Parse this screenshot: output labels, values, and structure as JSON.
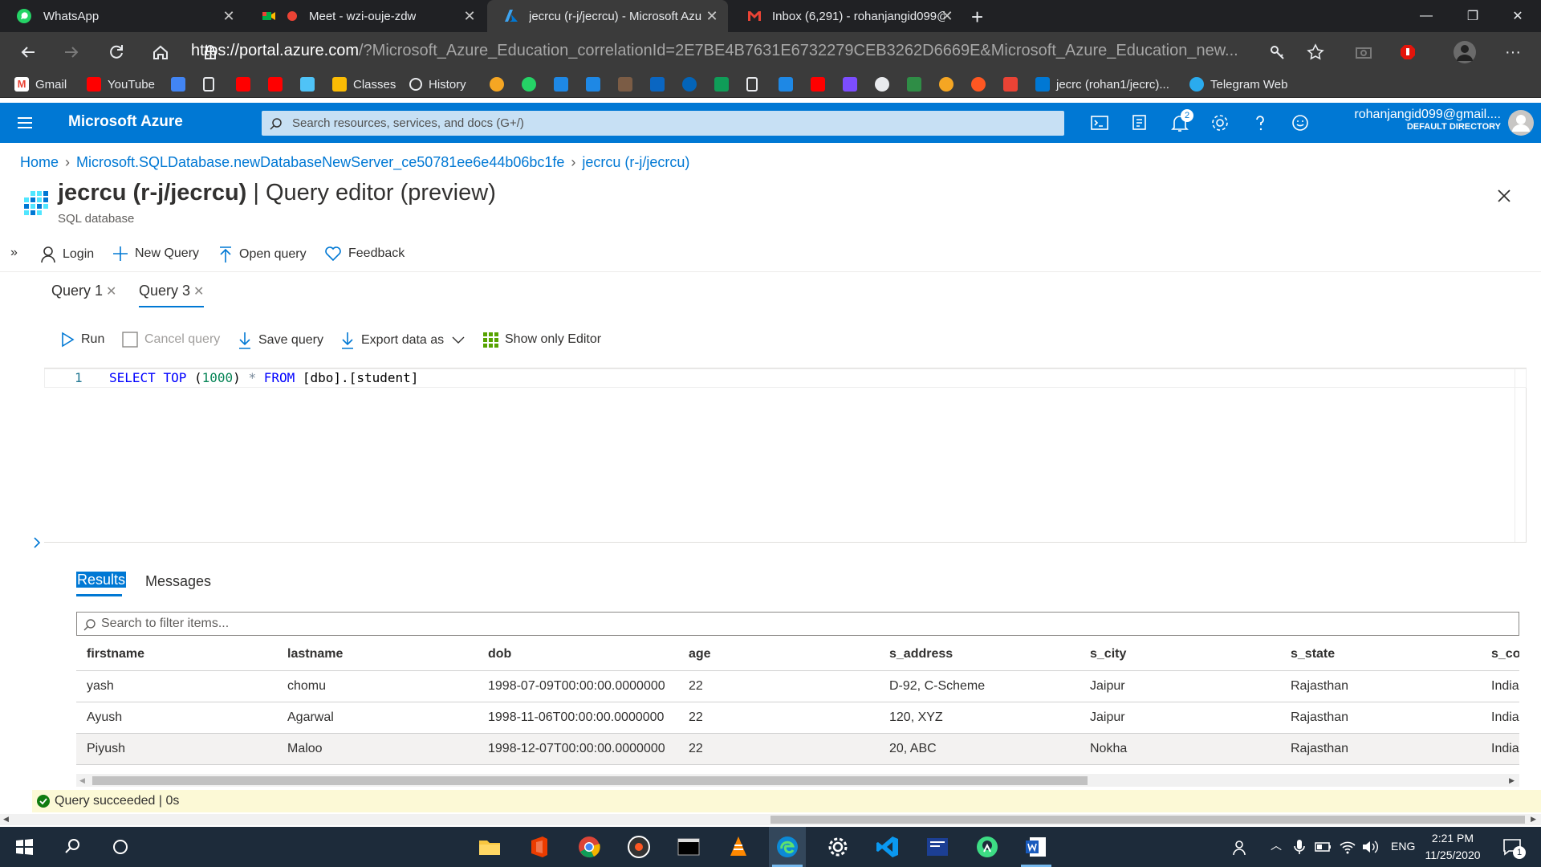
{
  "browser": {
    "tabs": [
      {
        "title": "WhatsApp",
        "icon": "whatsapp-icon"
      },
      {
        "title": "Meet - wzi-ouje-zdw",
        "icon": "google-meet-icon"
      },
      {
        "title": "jecrcu (r-j/jecrcu) - Microsoft Azu",
        "icon": "azure-icon",
        "active": true
      },
      {
        "title": "Inbox (6,291) - rohanjangid099@",
        "icon": "gmail-icon"
      }
    ],
    "url_main": "https://portal.azure.com",
    "url_rest": "/?Microsoft_Azure_Education_correlationId=2E7BE4B7631E6732279CEB3262D6669E&Microsoft_Azure_Education_new...",
    "bookmarks": {
      "gmail": "Gmail",
      "youtube": "YouTube",
      "classes": "Classes",
      "history": "History",
      "jecrc": "jecrc (rohan1/jecrc)...",
      "telegram": "Telegram Web"
    }
  },
  "azure": {
    "brand": "Microsoft Azure",
    "search_placeholder": "Search resources, services, and docs (G+/)",
    "notification_count": "2",
    "account_email": "rohanjangid099@gmail....",
    "account_directory": "DEFAULT DIRECTORY",
    "accent": "#0078d4"
  },
  "breadcrumb": {
    "home": "Home",
    "server": "Microsoft.SQLDatabase.newDatabaseNewServer_ce50781ee6e44b06bc1fe",
    "db": "jecrcu (r-j/jecrcu)"
  },
  "page": {
    "title_bold": "jecrcu (r-j/jecrcu)",
    "title_rest": " | Query editor (preview)",
    "subtitle": "SQL database"
  },
  "toolbar": {
    "login": "Login",
    "new_query": "New Query",
    "open_query": "Open query",
    "feedback": "Feedback"
  },
  "query_tabs": [
    "Query 1",
    "Query 3"
  ],
  "editor_toolbar": {
    "run": "Run",
    "cancel": "Cancel query",
    "save": "Save query",
    "export": "Export data as",
    "show_editor": "Show only Editor"
  },
  "editor": {
    "line_number": "1",
    "code": {
      "k1": "SELECT",
      "k2": "TOP",
      "p1": "(",
      "n": "1000",
      "p2": ")",
      "star": "*",
      "k3": "FROM",
      "obj": "[dbo].[student]"
    }
  },
  "results": {
    "tab_results": "Results",
    "tab_messages": "Messages",
    "filter_placeholder": "Search to filter items...",
    "columns": [
      "firstname",
      "lastname",
      "dob",
      "age",
      "s_address",
      "s_city",
      "s_state",
      "s_co"
    ],
    "rows": [
      [
        "yash",
        "chomu",
        "1998-07-09T00:00:00.0000000",
        "22",
        "D-92, C-Scheme",
        "Jaipur",
        "Rajasthan",
        "India"
      ],
      [
        "Ayush",
        "Agarwal",
        "1998-11-06T00:00:00.0000000",
        "22",
        "120, XYZ",
        "Jaipur",
        "Rajasthan",
        "India"
      ],
      [
        "Piyush",
        "Maloo",
        "1998-12-07T00:00:00.0000000",
        "22",
        "20, ABC",
        "Nokha",
        "Rajasthan",
        "India"
      ]
    ],
    "status": "Query succeeded | 0s"
  },
  "taskbar": {
    "lang": "ENG",
    "time": "2:21 PM",
    "date": "11/25/2020",
    "notif": "1"
  }
}
